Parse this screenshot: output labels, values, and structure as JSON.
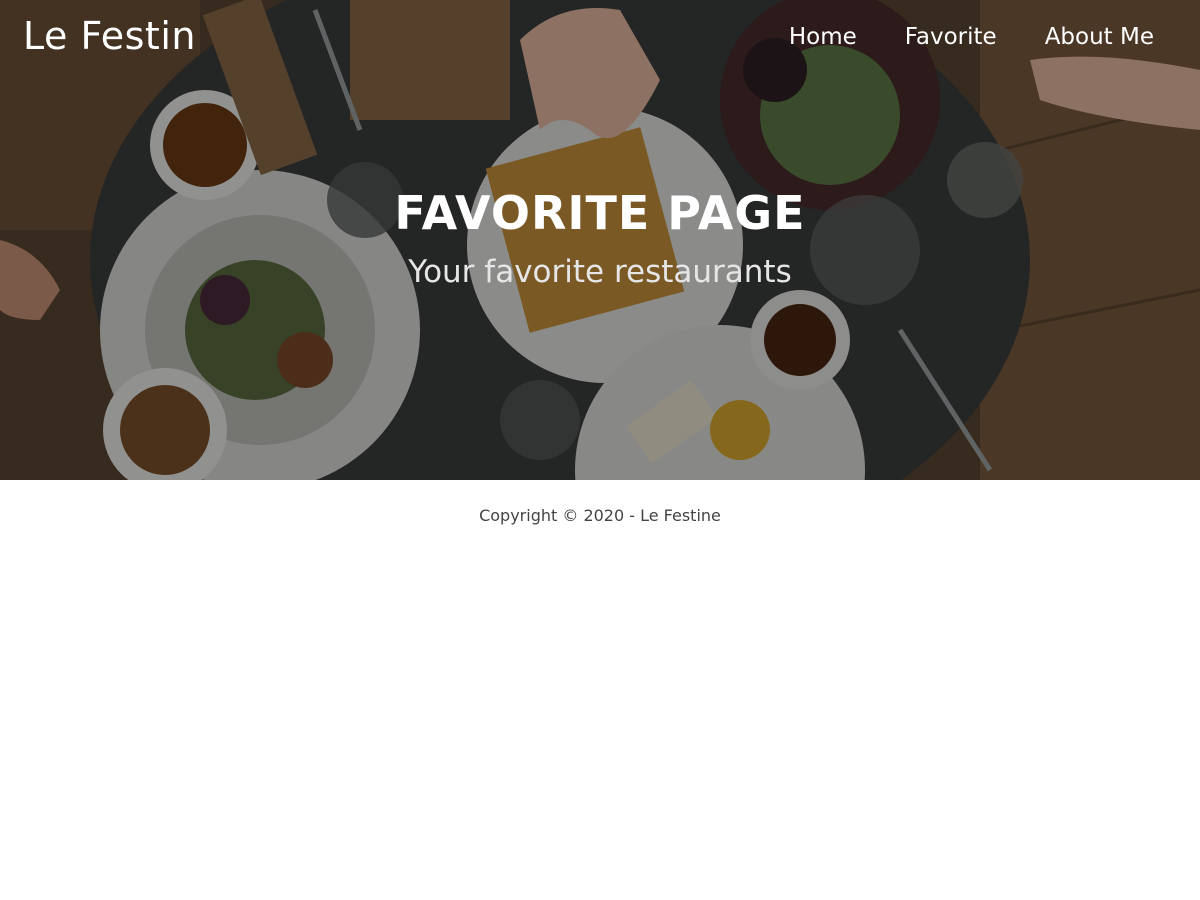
{
  "header": {
    "brand": "Le Festin",
    "nav": [
      {
        "label": "Home"
      },
      {
        "label": "Favorite"
      },
      {
        "label": "About Me"
      }
    ]
  },
  "hero": {
    "title": "FAVORITE PAGE",
    "subtitle": "Your favorite restaurants",
    "image": "restaurant-table-photo"
  },
  "footer": {
    "copyright": "Copyright © 2020 - Le Festine"
  },
  "colors": {
    "hero_overlay": "#000000",
    "text_light": "#ffffff",
    "footer_text": "#444444"
  }
}
